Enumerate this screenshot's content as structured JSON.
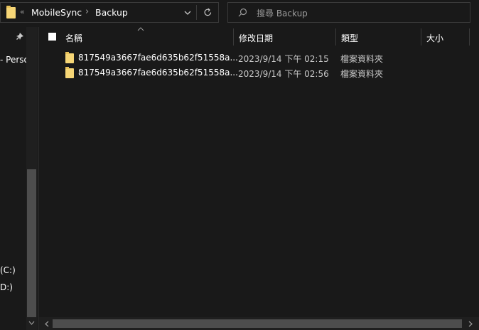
{
  "breadcrumb": {
    "overflow": "«",
    "items": [
      "MobileSync",
      "Backup"
    ],
    "separator": "›"
  },
  "search": {
    "placeholder": "搜尋 Backup"
  },
  "nav": {
    "items": [
      "- Perso",
      "(C:)",
      "D:)"
    ]
  },
  "columns": {
    "name": "名稱",
    "date": "修改日期",
    "type": "類型",
    "size": "大小"
  },
  "files": [
    {
      "name": "817549a3667fae6d635b62f51558a...",
      "date": "2023/9/14 下午 02:15",
      "type": "檔案資料夾"
    },
    {
      "name": "817549a3667fae6d635b62f51558a...",
      "date": "2023/9/14 下午 02:56",
      "type": "檔案資料夾"
    }
  ],
  "icons": {
    "folder": "folder-icon",
    "chevron_down": "chevron-down-icon",
    "refresh": "refresh-icon",
    "search": "search-icon",
    "pin": "pin-icon",
    "sort": "sort-up-icon"
  },
  "colors": {
    "background": "#191919",
    "folder": "#f6d676",
    "border": "#3a3a3a"
  }
}
